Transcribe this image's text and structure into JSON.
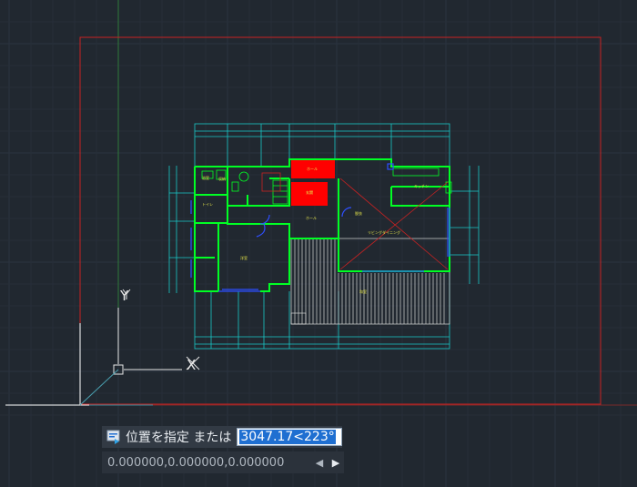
{
  "viewport": {
    "background": "#212830",
    "grid_color": "#2c3440",
    "border_color": "#c92222",
    "drawing_color": "#00ff24",
    "dimension_color": "#19c8c8",
    "fill_red": "#ff0000",
    "ucs_labels": {
      "y": "Y",
      "x": "X"
    }
  },
  "room_labels": [
    "ホール",
    "ホール",
    "玄関",
    "洋室",
    "和室",
    "トイレ",
    "収納",
    "リビングダイニング",
    "キッチン",
    "脱衣",
    "浴室"
  ],
  "command_line": {
    "icon": "command-prompt-icon",
    "prompt": "位置を指定 または",
    "input_value": "3047.17<223°"
  },
  "coordinates": {
    "value": "0.000000,0.000000,0.000000",
    "prev_icon": "arrow-left-icon",
    "next_icon": "arrow-right-icon"
  }
}
